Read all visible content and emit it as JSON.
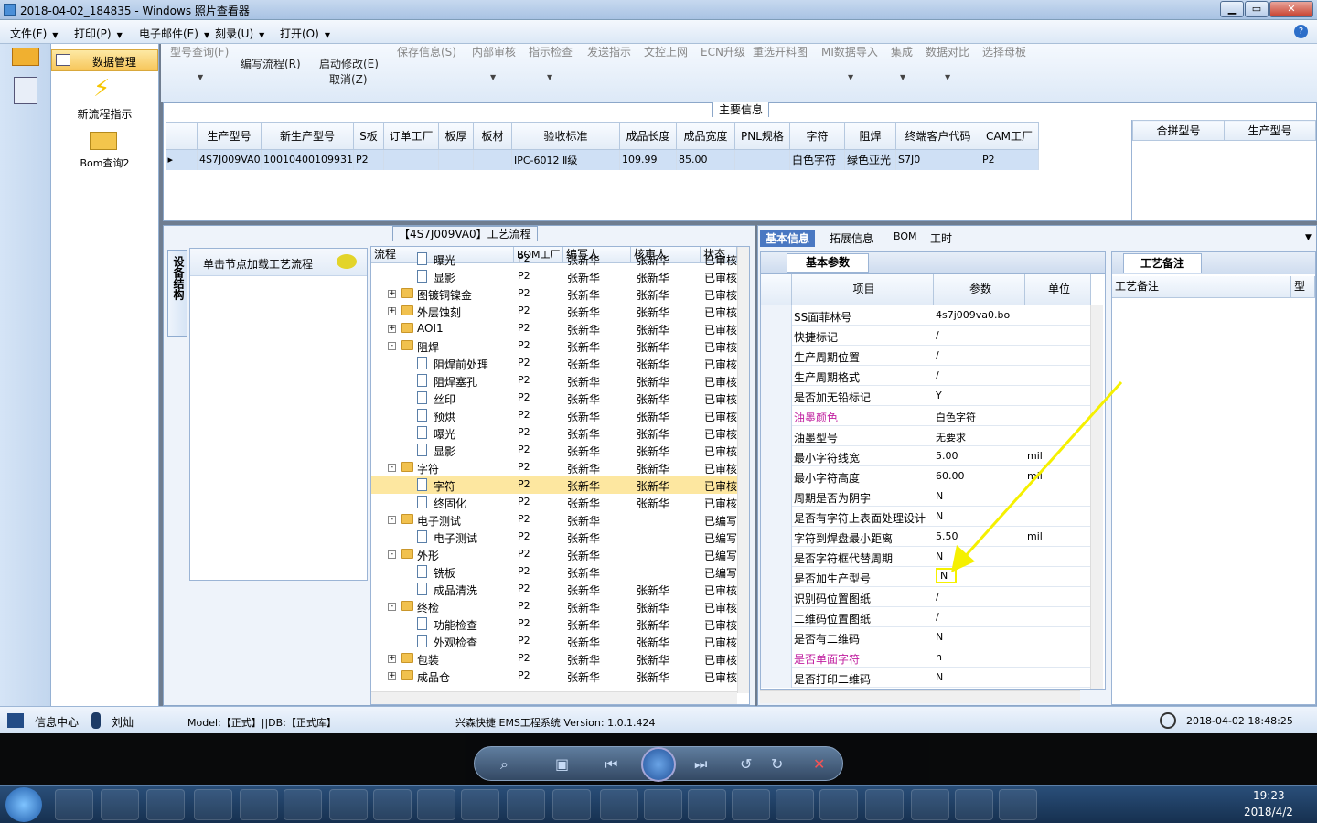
{
  "window": {
    "title": "2018-04-02_184835 - Windows 照片查看器",
    "min": "▁",
    "max": "▭",
    "close": "✕"
  },
  "menubar": {
    "items": [
      {
        "label": "文件(F)"
      },
      {
        "label": "打印(P)"
      },
      {
        "label": "电子邮件(E)"
      },
      {
        "label": "刻录(U)"
      },
      {
        "label": "打开(O)"
      }
    ],
    "help": "?"
  },
  "nav": {
    "header": "数据管理",
    "item1": "新流程指示",
    "item2": "Bom查询2"
  },
  "toolbar": {
    "t1": "型号查询(F)",
    "t2": "编写流程(R)",
    "t3": "启动修改(E)",
    "t4": "取消(Z)",
    "t5": "保存信息(S)",
    "t6": "内部审核",
    "t7": "指示检查",
    "t8": "发送指示",
    "t9": "文控上网",
    "t10": "ECN升级",
    "t11": "重选开料图",
    "t12": "MI数据导入",
    "t13": "集成",
    "t14": "数据对比",
    "t15": "选择母板"
  },
  "maininfo": {
    "title": "主要信息",
    "columns": [
      "生产型号",
      "新生产型号",
      "S板",
      "订单工厂",
      "板厚",
      "板材",
      "验收标准",
      "成品长度",
      "成品宽度",
      "PNL规格",
      "字符",
      "阻焊",
      "终端客户代码",
      "CAM工厂"
    ],
    "row": [
      "4S7J009VA0",
      "10010400109931",
      "P2",
      "",
      "",
      "",
      "IPC-6012 Ⅱ级",
      "109.99",
      "85.00",
      "",
      "白色字符",
      "绿色亚光",
      "S7J0",
      "P2"
    ],
    "side_columns": [
      "合拼型号",
      "生产型号"
    ]
  },
  "process": {
    "title": "【4S7J009VA0】工艺流程",
    "vtab": "设备结构",
    "load_label": "单击节点加载工艺流程",
    "columns": [
      "流程",
      "BOM工厂",
      "编写人",
      "核审人",
      "状态"
    ],
    "rows": [
      {
        "level": 2,
        "icon": "doc",
        "name": "曝光",
        "bom": "P2",
        "writer": "张新华",
        "checker": "张新华",
        "status": "已审核"
      },
      {
        "level": 2,
        "icon": "doc",
        "name": "显影",
        "bom": "P2",
        "writer": "张新华",
        "checker": "张新华",
        "status": "已审核"
      },
      {
        "level": 1,
        "icon": "folder",
        "exp": "+",
        "name": "图镀铜镍金",
        "bom": "P2",
        "writer": "张新华",
        "checker": "张新华",
        "status": "已审核"
      },
      {
        "level": 1,
        "icon": "folder",
        "exp": "+",
        "name": "外层蚀刻",
        "bom": "P2",
        "writer": "张新华",
        "checker": "张新华",
        "status": "已审核"
      },
      {
        "level": 1,
        "icon": "folder",
        "exp": "+",
        "name": "AOI1",
        "bom": "P2",
        "writer": "张新华",
        "checker": "张新华",
        "status": "已审核"
      },
      {
        "level": 1,
        "icon": "folder",
        "exp": "-",
        "name": "阻焊",
        "bom": "P2",
        "writer": "张新华",
        "checker": "张新华",
        "status": "已审核"
      },
      {
        "level": 2,
        "icon": "doc",
        "name": "阻焊前处理",
        "bom": "P2",
        "writer": "张新华",
        "checker": "张新华",
        "status": "已审核"
      },
      {
        "level": 2,
        "icon": "doc",
        "name": "阻焊塞孔",
        "bom": "P2",
        "writer": "张新华",
        "checker": "张新华",
        "status": "已审核"
      },
      {
        "level": 2,
        "icon": "doc",
        "name": "丝印",
        "bom": "P2",
        "writer": "张新华",
        "checker": "张新华",
        "status": "已审核"
      },
      {
        "level": 2,
        "icon": "doc",
        "name": "预烘",
        "bom": "P2",
        "writer": "张新华",
        "checker": "张新华",
        "status": "已审核"
      },
      {
        "level": 2,
        "icon": "doc",
        "name": "曝光",
        "bom": "P2",
        "writer": "张新华",
        "checker": "张新华",
        "status": "已审核"
      },
      {
        "level": 2,
        "icon": "doc",
        "name": "显影",
        "bom": "P2",
        "writer": "张新华",
        "checker": "张新华",
        "status": "已审核"
      },
      {
        "level": 1,
        "icon": "folder",
        "exp": "-",
        "name": "字符",
        "bom": "P2",
        "writer": "张新华",
        "checker": "张新华",
        "status": "已审核"
      },
      {
        "level": 2,
        "icon": "doc",
        "name": "字符",
        "bom": "P2",
        "writer": "张新华",
        "checker": "张新华",
        "status": "已审核",
        "selected": true
      },
      {
        "level": 2,
        "icon": "doc",
        "name": "终固化",
        "bom": "P2",
        "writer": "张新华",
        "checker": "张新华",
        "status": "已审核"
      },
      {
        "level": 1,
        "icon": "folder",
        "exp": "-",
        "name": "电子测试",
        "bom": "P2",
        "writer": "张新华",
        "checker": "",
        "status": "已编写"
      },
      {
        "level": 2,
        "icon": "doc",
        "name": "电子测试",
        "bom": "P2",
        "writer": "张新华",
        "checker": "",
        "status": "已编写"
      },
      {
        "level": 1,
        "icon": "folder",
        "exp": "-",
        "name": "外形",
        "bom": "P2",
        "writer": "张新华",
        "checker": "",
        "status": "已编写"
      },
      {
        "level": 2,
        "icon": "doc",
        "name": "铣板",
        "bom": "P2",
        "writer": "张新华",
        "checker": "",
        "status": "已编写"
      },
      {
        "level": 2,
        "icon": "doc",
        "name": "成品清洗",
        "bom": "P2",
        "writer": "张新华",
        "checker": "张新华",
        "status": "已审核"
      },
      {
        "level": 1,
        "icon": "folder",
        "exp": "-",
        "name": "终检",
        "bom": "P2",
        "writer": "张新华",
        "checker": "张新华",
        "status": "已审核"
      },
      {
        "level": 2,
        "icon": "doc",
        "name": "功能检查",
        "bom": "P2",
        "writer": "张新华",
        "checker": "张新华",
        "status": "已审核"
      },
      {
        "level": 2,
        "icon": "doc",
        "name": "外观检查",
        "bom": "P2",
        "writer": "张新华",
        "checker": "张新华",
        "status": "已审核"
      },
      {
        "level": 1,
        "icon": "folder",
        "exp": "+",
        "name": "包装",
        "bom": "P2",
        "writer": "张新华",
        "checker": "张新华",
        "status": "已审核"
      },
      {
        "level": 1,
        "icon": "folder",
        "exp": "+",
        "name": "成品仓",
        "bom": "P2",
        "writer": "张新华",
        "checker": "张新华",
        "status": "已审核"
      }
    ]
  },
  "detail": {
    "tabs": [
      "基本信息",
      "拓展信息",
      "BOM",
      "工时"
    ],
    "subtab": "基本参数",
    "columns": [
      "项目",
      "参数",
      "单位"
    ],
    "rows": [
      {
        "item": "SS面菲林号",
        "value": "4s7j009va0.bo",
        "unit": ""
      },
      {
        "item": "快捷标记",
        "value": "/",
        "unit": ""
      },
      {
        "item": "生产周期位置",
        "value": "/",
        "unit": ""
      },
      {
        "item": "生产周期格式",
        "value": "/",
        "unit": ""
      },
      {
        "item": "是否加无铅标记",
        "value": "Y",
        "unit": ""
      },
      {
        "item": "油墨颜色",
        "value": "白色字符",
        "unit": "",
        "highlight": true
      },
      {
        "item": "油墨型号",
        "value": "无要求",
        "unit": ""
      },
      {
        "item": "最小字符线宽",
        "value": "5.00",
        "unit": "mil"
      },
      {
        "item": "最小字符高度",
        "value": "60.00",
        "unit": "mil"
      },
      {
        "item": "周期是否为阴字",
        "value": "N",
        "unit": ""
      },
      {
        "item": "是否有字符上表面处理设计",
        "value": "N",
        "unit": ""
      },
      {
        "item": "字符到焊盘最小距离",
        "value": "5.50",
        "unit": "mil"
      },
      {
        "item": "是否字符框代替周期",
        "value": "N",
        "unit": ""
      },
      {
        "item": "是否加生产型号",
        "value": "N",
        "unit": "",
        "boxed": true
      },
      {
        "item": "识别码位置图纸",
        "value": "/",
        "unit": ""
      },
      {
        "item": "二维码位置图纸",
        "value": "/",
        "unit": ""
      },
      {
        "item": "是否有二维码",
        "value": "N",
        "unit": ""
      },
      {
        "item": "是否单面字符",
        "value": "n",
        "unit": "",
        "highlight": true
      },
      {
        "item": "是否打印二维码",
        "value": "N",
        "unit": ""
      }
    ],
    "remark_tab": "工艺备注",
    "remark_col": "工艺备注",
    "remark_col2": "型"
  },
  "status": {
    "info": "信息中心",
    "user": "刘灿",
    "model": "Model:【正式】||DB:【正式库】",
    "system": "兴森快捷 EMS工程系统 Version: 1.0.1.424",
    "time": "2018-04-02 18:48:25"
  },
  "taskbar": {
    "time": "19:23",
    "date": "2018/4/2"
  },
  "colors": {
    "accent": "#4a78c2",
    "selected": "#fde7a0",
    "highlight_text": "#c020a0",
    "arrow": "#f5f000"
  }
}
